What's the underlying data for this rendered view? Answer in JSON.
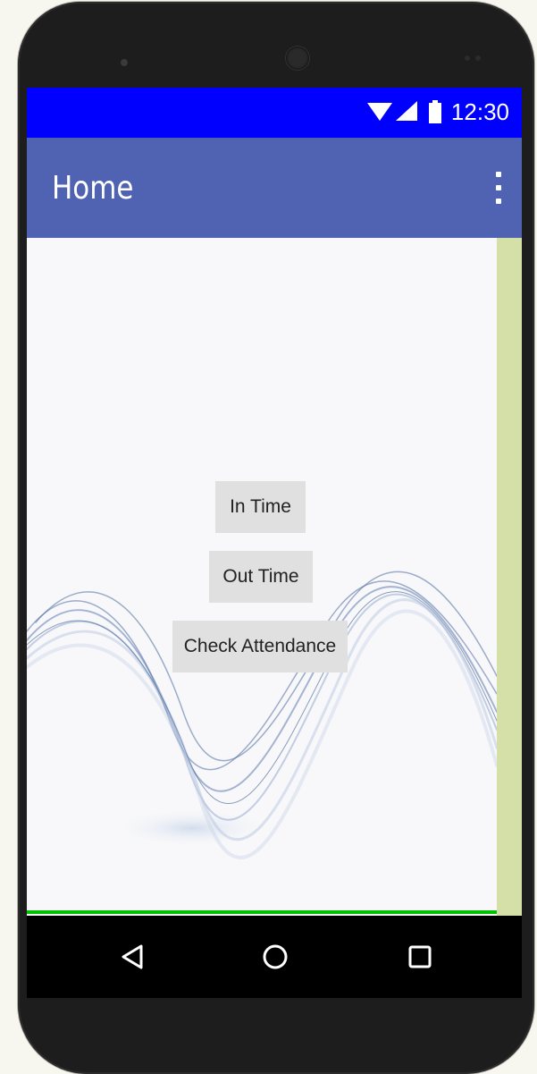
{
  "status_bar": {
    "time": "12:30",
    "icons": [
      "wifi-icon",
      "signal-icon",
      "battery-icon"
    ]
  },
  "app_bar": {
    "title": "Home",
    "menu_icon": "more-vert-icon"
  },
  "buttons": {
    "in_time": "In Time",
    "out_time": "Out Time",
    "check_attendance": "Check Attendance"
  },
  "nav_bar": {
    "icons": [
      "back-icon",
      "home-icon",
      "recent-apps-icon"
    ]
  },
  "colors": {
    "status_bar": "#0000ff",
    "app_bar": "#5063b3",
    "scroll_strip": "#d4e0a8",
    "bottom_line": "#00c000",
    "button_bg": "#e0e0e0"
  }
}
